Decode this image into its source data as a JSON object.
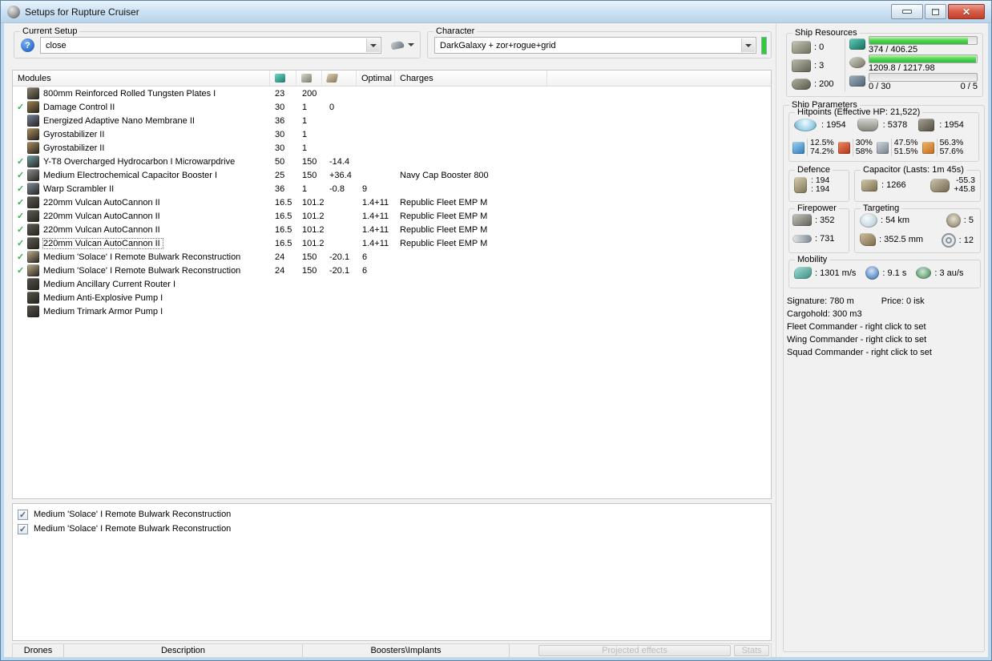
{
  "window": {
    "title": "Setups for Rupture Cruiser"
  },
  "toolbar": {
    "current_setup": {
      "label": "Current Setup",
      "value": "close"
    },
    "character": {
      "label": "Character",
      "value": "DarkGalaxy + zor+rogue+grid"
    }
  },
  "ui_colors": {
    "progress_green": "#3fd03f",
    "fitted_check_green": "#3fae49",
    "character_status_green": "#33cc33"
  },
  "modules_table": {
    "columns": {
      "modules": "Modules",
      "optimal": "Optimal",
      "charges": "Charges"
    },
    "icon_columns": [
      "cpu-column-icon",
      "powergrid-column-icon",
      "capacitor-column-icon"
    ],
    "rows": [
      {
        "fitted": false,
        "focused": false,
        "icon": "armor-plate-icon",
        "color": "#8f8672",
        "name": "800mm Reinforced Rolled Tungsten Plates I",
        "cpu": "23",
        "pg": "200",
        "cap": "",
        "opt": "",
        "charge": ""
      },
      {
        "fitted": true,
        "focused": false,
        "icon": "damage-control-icon",
        "color": "#a28250",
        "name": "Damage Control II",
        "cpu": "30",
        "pg": "1",
        "cap": "0",
        "opt": "",
        "charge": ""
      },
      {
        "fitted": false,
        "focused": false,
        "icon": "nano-membrane-icon",
        "color": "#75839f",
        "name": "Energized Adaptive Nano Membrane II",
        "cpu": "36",
        "pg": "1",
        "cap": "",
        "opt": "",
        "charge": ""
      },
      {
        "fitted": false,
        "focused": false,
        "icon": "gyrostabilizer-icon",
        "color": "#b08f5e",
        "name": "Gyrostabilizer II",
        "cpu": "30",
        "pg": "1",
        "cap": "",
        "opt": "",
        "charge": ""
      },
      {
        "fitted": false,
        "focused": false,
        "icon": "gyrostabilizer-icon",
        "color": "#b08f5e",
        "name": "Gyrostabilizer II",
        "cpu": "30",
        "pg": "1",
        "cap": "",
        "opt": "",
        "charge": ""
      },
      {
        "fitted": true,
        "focused": false,
        "icon": "microwarpdrive-icon",
        "color": "#6fa1a8",
        "name": "Y-T8 Overcharged Hydrocarbon I Microwarpdrive",
        "cpu": "50",
        "pg": "150",
        "cap": "-14.4",
        "opt": "",
        "charge": ""
      },
      {
        "fitted": true,
        "focused": false,
        "icon": "cap-booster-module-icon",
        "color": "#8f8f8f",
        "name": "Medium Electrochemical Capacitor Booster I",
        "cpu": "25",
        "pg": "150",
        "cap": "+36.4",
        "opt": "",
        "charge": "Navy Cap Booster 800"
      },
      {
        "fitted": true,
        "focused": false,
        "icon": "warp-scrambler-icon",
        "color": "#7f8fa0",
        "name": "Warp Scrambler II",
        "cpu": "36",
        "pg": "1",
        "cap": "-0.8",
        "opt": "9",
        "charge": ""
      },
      {
        "fitted": true,
        "focused": false,
        "icon": "autocannon-icon",
        "color": "#5f5d55",
        "name": "220mm Vulcan AutoCannon II",
        "cpu": "16.5",
        "pg": "101.2",
        "cap": "",
        "opt": "1.4+11",
        "charge": "Republic Fleet EMP M"
      },
      {
        "fitted": true,
        "focused": false,
        "icon": "autocannon-icon",
        "color": "#5f5d55",
        "name": "220mm Vulcan AutoCannon II",
        "cpu": "16.5",
        "pg": "101.2",
        "cap": "",
        "opt": "1.4+11",
        "charge": "Republic Fleet EMP M"
      },
      {
        "fitted": true,
        "focused": false,
        "icon": "autocannon-icon",
        "color": "#5f5d55",
        "name": "220mm Vulcan AutoCannon II",
        "cpu": "16.5",
        "pg": "101.2",
        "cap": "",
        "opt": "1.4+11",
        "charge": "Republic Fleet EMP M"
      },
      {
        "fitted": true,
        "focused": true,
        "icon": "autocannon-icon",
        "color": "#5f5d55",
        "name": "220mm Vulcan AutoCannon II",
        "cpu": "16.5",
        "pg": "101.2",
        "cap": "",
        "opt": "1.4+11",
        "charge": "Republic Fleet EMP M"
      },
      {
        "fitted": true,
        "focused": false,
        "icon": "remote-armor-repairer-icon",
        "color": "#bfae8c",
        "name": "Medium 'Solace' I Remote Bulwark Reconstruction",
        "cpu": "24",
        "pg": "150",
        "cap": "-20.1",
        "opt": "6",
        "charge": ""
      },
      {
        "fitted": true,
        "focused": false,
        "icon": "remote-armor-repairer-icon",
        "color": "#bfae8c",
        "name": "Medium 'Solace' I Remote Bulwark Reconstruction",
        "cpu": "24",
        "pg": "150",
        "cap": "-20.1",
        "opt": "6",
        "charge": ""
      },
      {
        "fitted": false,
        "focused": false,
        "icon": "ancillary-current-router-icon",
        "color": "#55524b",
        "name": "Medium Ancillary Current Router I",
        "cpu": "",
        "pg": "",
        "cap": "",
        "opt": "",
        "charge": ""
      },
      {
        "fitted": false,
        "focused": false,
        "icon": "anti-explosive-pump-icon",
        "color": "#565349",
        "name": "Medium Anti-Explosive Pump I",
        "cpu": "",
        "pg": "",
        "cap": "",
        "opt": "",
        "charge": ""
      },
      {
        "fitted": false,
        "focused": false,
        "icon": "trimark-armor-pump-icon",
        "color": "#565349",
        "name": "Medium Trimark Armor Pump I",
        "cpu": "",
        "pg": "",
        "cap": "",
        "opt": "",
        "charge": ""
      }
    ]
  },
  "ship_resources": {
    "title": "Ship Resources",
    "turret_slots": "0",
    "launcher_slots": "3",
    "calibration": "200",
    "cpu": {
      "text": "374 / 406.25",
      "percent": 92
    },
    "powergrid": {
      "text": "1209.8 / 1217.98",
      "percent": 99
    },
    "drones": {
      "bandwidth_text": "0 / 30",
      "slots_text": "0 / 5",
      "percent": 0
    }
  },
  "ship_parameters": {
    "title": "Ship Parameters",
    "hitpoints": {
      "title": "Hitpoints (Effective HP: 21,522)",
      "shield": "1954",
      "armor": "5378",
      "hull": "1954",
      "resists": {
        "em": [
          "12.5%",
          "74.2%"
        ],
        "thermal": [
          "30%",
          "58%"
        ],
        "kinetic": [
          "47.5%",
          "51.5%"
        ],
        "explosive": [
          "56.3%",
          "57.6%"
        ]
      }
    },
    "defence": {
      "title": "Defence",
      "values": [
        "194",
        "194"
      ]
    },
    "capacitor": {
      "title": "Capacitor (Lasts: 1m 45s)",
      "amount": "1266",
      "delta": [
        "-55.3",
        "+45.8"
      ]
    },
    "firepower": {
      "title": "Firepower",
      "volley": "352",
      "dps": "731"
    },
    "targeting": {
      "title": "Targeting",
      "range": "54 km",
      "max_targets": "5",
      "scan_resolution": "352.5 mm",
      "sensor_strength": "12"
    },
    "mobility": {
      "title": "Mobility",
      "speed": "1301 m/s",
      "align_time": "9.1 s",
      "warp_speed": "3 au/s"
    },
    "info": {
      "signature": "Signature: 780 m",
      "price": "Price: 0 isk",
      "cargohold": "Cargohold: 300 m3",
      "fleet": "Fleet Commander - right click to set",
      "wing": "Wing Commander - right click to set",
      "squad": "Squad Commander - right click to set"
    }
  },
  "bottom_panel": {
    "items": [
      {
        "checked": true,
        "label": "Medium 'Solace' I Remote Bulwark Reconstruction"
      },
      {
        "checked": true,
        "label": "Medium 'Solace' I Remote Bulwark Reconstruction"
      }
    ]
  },
  "footer": {
    "tabs": [
      "Drones",
      "Description",
      "Boosters\\Implants"
    ],
    "projected_effects": "Projected effects",
    "stats": "Stats"
  }
}
